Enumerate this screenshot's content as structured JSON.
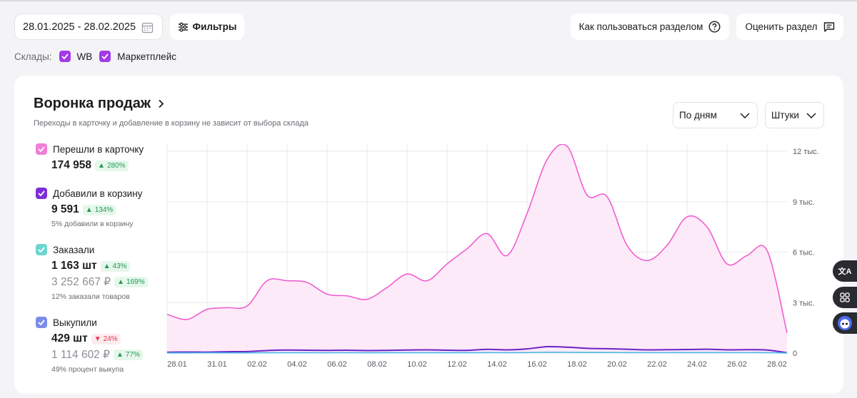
{
  "toolbar": {
    "date_range": "28.01.2025 - 28.02.2025",
    "filters_label": "Фильтры",
    "howto_label": "Как пользоваться разделом",
    "rate_label": "Оценить раздел"
  },
  "warehouses": {
    "label": "Склады:",
    "items": [
      {
        "label": "WB",
        "checked": true
      },
      {
        "label": "Маркетплейс",
        "checked": true
      }
    ]
  },
  "funnel": {
    "title": "Воронка продаж",
    "subtitle": "Переходы в карточку и добавление в корзину не зависит от выбора склада",
    "period_select": "По дням",
    "unit_select": "Штуки",
    "metrics": [
      {
        "label": "Перешли в карточку",
        "color": "#f07fd6",
        "value": "174 958",
        "change": "280%",
        "trend": "up"
      },
      {
        "label": "Добавили в корзину",
        "color": "#7b2fd6",
        "value": "9 591",
        "change": "134%",
        "trend": "up",
        "note": "5% добавили в корзину"
      },
      {
        "label": "Заказали",
        "color": "#6ed6d0",
        "value": "1 163 шт",
        "change": "43%",
        "trend": "up",
        "value2": "3 252 667 ₽",
        "change2": "169%",
        "trend2": "up",
        "note": "12% заказали товаров"
      },
      {
        "label": "Выкупили",
        "color": "#7b8ce8",
        "value": "429 шт",
        "change": "24%",
        "trend": "down",
        "value2": "1 114 602 ₽",
        "change2": "77%",
        "trend2": "up",
        "note": "49% процент выкупа"
      }
    ]
  },
  "chart_data": {
    "type": "area",
    "x_ticks": [
      "28.01",
      "31.01",
      "02.02",
      "04.02",
      "06.02",
      "08.02",
      "10.02",
      "12.02",
      "14.02",
      "16.02",
      "18.02",
      "20.02",
      "22.02",
      "24.02",
      "26.02",
      "28.02"
    ],
    "y_ticks": [
      "0",
      "3 тыс.",
      "6 тыс.",
      "9 тыс.",
      "12 тыс."
    ],
    "ylim": [
      0,
      12000
    ],
    "grid": true,
    "series": [
      {
        "name": "Перешли в карточку",
        "color": "#ee5fd0",
        "values": [
          2300,
          2000,
          2600,
          2700,
          2800,
          4300,
          4300,
          4200,
          3500,
          3400,
          3200,
          3900,
          4700,
          4300,
          5300,
          6200,
          7100,
          5800,
          8300,
          11500,
          12300,
          9400,
          9300,
          6400,
          5500,
          6400,
          8100,
          7500,
          5300,
          5800,
          6100,
          1200
        ]
      },
      {
        "name": "Добавили в корзину",
        "color": "#6a22c8",
        "values": [
          50,
          60,
          55,
          80,
          90,
          150,
          180,
          170,
          160,
          170,
          150,
          160,
          180,
          190,
          170,
          160,
          220,
          190,
          250,
          380,
          350,
          280,
          260,
          230,
          190,
          200,
          210,
          230,
          190,
          200,
          180,
          20
        ]
      },
      {
        "name": "Заказали",
        "color": "#4ab8e8",
        "values": [
          10,
          10,
          12,
          12,
          15,
          20,
          22,
          22,
          20,
          22,
          20,
          22,
          24,
          25,
          23,
          22,
          28,
          25,
          30,
          45,
          42,
          35,
          33,
          30,
          26,
          27,
          28,
          30,
          26,
          27,
          25,
          3
        ]
      }
    ]
  }
}
